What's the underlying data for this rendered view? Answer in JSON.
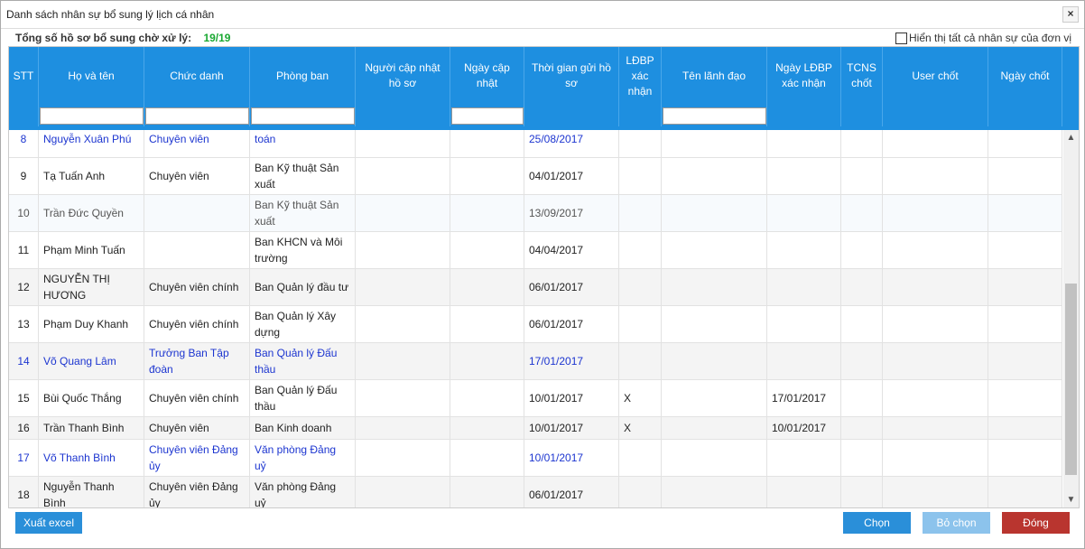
{
  "dialog": {
    "title": "Danh sách nhân sự bổ sung lý lịch cá nhân",
    "close_label": "×"
  },
  "summary": {
    "label": "Tổng số hồ sơ bổ sung chờ xử lý:",
    "count": "19/19"
  },
  "show_all": {
    "label": "Hiển thị tất cả nhân sự của đơn vị",
    "checked": false
  },
  "columns": [
    "STT",
    "Họ và tên",
    "Chức danh",
    "Phòng ban",
    "Người cập nhật hồ sơ",
    "Ngày cập nhật",
    "Thời gian gửi hồ sơ",
    "LĐBP xác nhận",
    "Tên lãnh đạo",
    "Ngày LĐBP xác nhận",
    "TCNS chốt",
    "User chốt",
    "Ngày chốt"
  ],
  "rows": [
    {
      "stt": "8",
      "name": "Nguyễn Xuân Phú",
      "title": "Chuyên viên",
      "dept": "toán",
      "updater": "",
      "update_date": "",
      "sent": "25/08/2017",
      "ldbp": "",
      "leader": "",
      "ldbp_date": "",
      "tcns": "",
      "user": "",
      "close_date": "",
      "style": "blue"
    },
    {
      "stt": "9",
      "name": "Tạ Tuấn Anh",
      "title": "Chuyên viên",
      "dept": "Ban Kỹ thuật Sản xuất",
      "updater": "",
      "update_date": "",
      "sent": "04/01/2017",
      "ldbp": "",
      "leader": "",
      "ldbp_date": "",
      "tcns": "",
      "user": "",
      "close_date": "",
      "style": "normal"
    },
    {
      "stt": "10",
      "name": "Trần Đức Quyền",
      "title": "",
      "dept": "Ban Kỹ thuật Sản xuất",
      "updater": "",
      "update_date": "",
      "sent": "13/09/2017",
      "ldbp": "",
      "leader": "",
      "ldbp_date": "",
      "tcns": "",
      "user": "",
      "close_date": "",
      "style": "gray"
    },
    {
      "stt": "11",
      "name": "Phạm Minh Tuấn",
      "title": "",
      "dept": "Ban KHCN và Môi trường",
      "updater": "",
      "update_date": "",
      "sent": "04/04/2017",
      "ldbp": "",
      "leader": "",
      "ldbp_date": "",
      "tcns": "",
      "user": "",
      "close_date": "",
      "style": "normal"
    },
    {
      "stt": "12",
      "name": "NGUYỄN THỊ HƯƠNG",
      "title": "Chuyên viên chính",
      "dept": "Ban Quản lý đầu tư",
      "updater": "",
      "update_date": "",
      "sent": "06/01/2017",
      "ldbp": "",
      "leader": "",
      "ldbp_date": "",
      "tcns": "",
      "user": "",
      "close_date": "",
      "style": "alt"
    },
    {
      "stt": "13",
      "name": "Phạm Duy Khanh",
      "title": "Chuyên viên chính",
      "dept": "Ban Quản lý Xây dựng",
      "updater": "",
      "update_date": "",
      "sent": "06/01/2017",
      "ldbp": "",
      "leader": "",
      "ldbp_date": "",
      "tcns": "",
      "user": "",
      "close_date": "",
      "style": "normal"
    },
    {
      "stt": "14",
      "name": "Võ Quang Lâm",
      "title": "Trưởng Ban Tập đoàn",
      "dept": "Ban Quản lý Đấu thầu",
      "updater": "",
      "update_date": "",
      "sent": "17/01/2017",
      "ldbp": "",
      "leader": "",
      "ldbp_date": "",
      "tcns": "",
      "user": "",
      "close_date": "",
      "style": "blue-alt"
    },
    {
      "stt": "15",
      "name": "Bùi Quốc Thắng",
      "title": "Chuyên viên chính",
      "dept": "Ban Quản lý Đấu thầu",
      "updater": "",
      "update_date": "",
      "sent": "10/01/2017",
      "ldbp": "X",
      "leader": "",
      "ldbp_date": "17/01/2017",
      "tcns": "",
      "user": "",
      "close_date": "",
      "style": "normal"
    },
    {
      "stt": "16",
      "name": "Trần Thanh Bình",
      "title": "Chuyên viên",
      "dept": "Ban Kinh doanh",
      "updater": "",
      "update_date": "",
      "sent": "10/01/2017",
      "ldbp": "X",
      "leader": "",
      "ldbp_date": "10/01/2017",
      "tcns": "",
      "user": "",
      "close_date": "",
      "style": "alt"
    },
    {
      "stt": "17",
      "name": "Võ Thanh Bình",
      "title": "Chuyên viên Đảng ủy",
      "dept": "Văn phòng Đảng uỷ",
      "updater": "",
      "update_date": "",
      "sent": "10/01/2017",
      "ldbp": "",
      "leader": "",
      "ldbp_date": "",
      "tcns": "",
      "user": "",
      "close_date": "",
      "style": "blue"
    },
    {
      "stt": "18",
      "name": "Nguyễn Thanh Bình",
      "title": "Chuyên viên Đảng ủy",
      "dept": "Văn phòng Đảng uỷ",
      "updater": "",
      "update_date": "",
      "sent": "06/01/2017",
      "ldbp": "",
      "leader": "",
      "ldbp_date": "",
      "tcns": "",
      "user": "",
      "close_date": "",
      "style": "alt"
    }
  ],
  "buttons": {
    "export": "Xuất excel",
    "select": "Chọn",
    "deselect": "Bỏ chọn",
    "close": "Đóng"
  }
}
